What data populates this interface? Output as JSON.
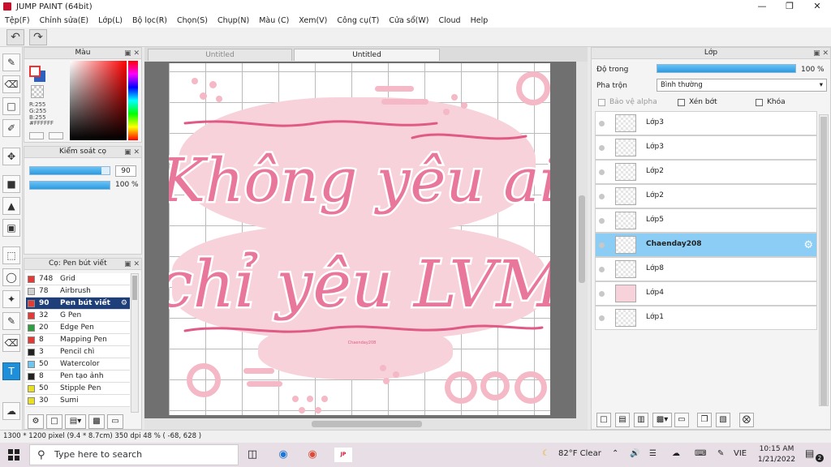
{
  "window": {
    "title": "JUMP PAINT (64bit)"
  },
  "menu": [
    "Tệp(F)",
    "Chỉnh sửa(E)",
    "Lớp(L)",
    "Bộ lọc(R)",
    "Chọn(S)",
    "Chụp(N)",
    "Màu (C)",
    "Xem(V)",
    "Công cụ(T)",
    "Cửa sổ(W)",
    "Cloud",
    "Help"
  ],
  "color_panel": {
    "title": "Màu",
    "r": "R:255",
    "g": "G:255",
    "b": "B:255",
    "hex": "#FFFFFF"
  },
  "brush_control": {
    "title": "Kiểm soát cọ",
    "size_value": "90",
    "size_level": 0.9,
    "opacity_value": "100 %",
    "opacity_level": 1.0
  },
  "brush_list": {
    "title": "Cọ: Pen bút viết",
    "items": [
      {
        "size": "748",
        "name": "Grid",
        "color": "#e53935"
      },
      {
        "size": "78",
        "name": "Airbrush",
        "color": "#d0d0d0"
      },
      {
        "size": "90",
        "name": "Pen bút viết",
        "color": "#e53935",
        "selected": true
      },
      {
        "size": "32",
        "name": "G Pen",
        "color": "#e53935"
      },
      {
        "size": "20",
        "name": "Edge Pen",
        "color": "#2e9e3e"
      },
      {
        "size": "8",
        "name": "Mapping Pen",
        "color": "#e53935"
      },
      {
        "size": "3",
        "name": "Pencil chì",
        "color": "#222222"
      },
      {
        "size": "50",
        "name": "Watercolor",
        "color": "#6ec6f0"
      },
      {
        "size": "8",
        "name": "Pen tạo ảnh",
        "color": "#222222"
      },
      {
        "size": "50",
        "name": "Stipple Pen",
        "color": "#e8e020"
      },
      {
        "size": "30",
        "name": "Sumi",
        "color": "#e8e020"
      }
    ]
  },
  "doc_tabs": [
    "Untitled",
    "Untitled"
  ],
  "canvas": {
    "line1": "Không yêu ai",
    "line2": "chỉ yêu LVM",
    "signature": "Chaenday208",
    "colors": {
      "ink": "#e05a86",
      "light": "#f7d2da",
      "accent": "#f4b8c6"
    }
  },
  "layer_panel": {
    "title": "Lớp",
    "opacity_label": "Độ trong",
    "opacity_value": "100 %",
    "opacity_level": 1.0,
    "blend_label": "Pha trộn",
    "blend_value": "Bình thường",
    "protect_alpha": "Bảo vệ alpha",
    "clipping": "Xén bớt",
    "lock": "Khóa",
    "layers": [
      {
        "name": "Lớp3"
      },
      {
        "name": "Lớp3"
      },
      {
        "name": "Lớp2"
      },
      {
        "name": "Lớp2"
      },
      {
        "name": "Lớp5"
      },
      {
        "name": "Chaenday208",
        "selected": true
      },
      {
        "name": "Lớp8"
      },
      {
        "name": "Lớp4"
      },
      {
        "name": "Lớp1"
      }
    ]
  },
  "status": {
    "text": "1300 * 1200 pixel  (9.4 * 8.7cm)  350 dpi  48 %  ( -68, 628 )"
  },
  "taskbar": {
    "search_placeholder": "Type here to search",
    "weather": "82°F  Clear",
    "lang": "VIE",
    "time": "10:15 AM",
    "date": "1/21/2022",
    "notifications": "2"
  }
}
